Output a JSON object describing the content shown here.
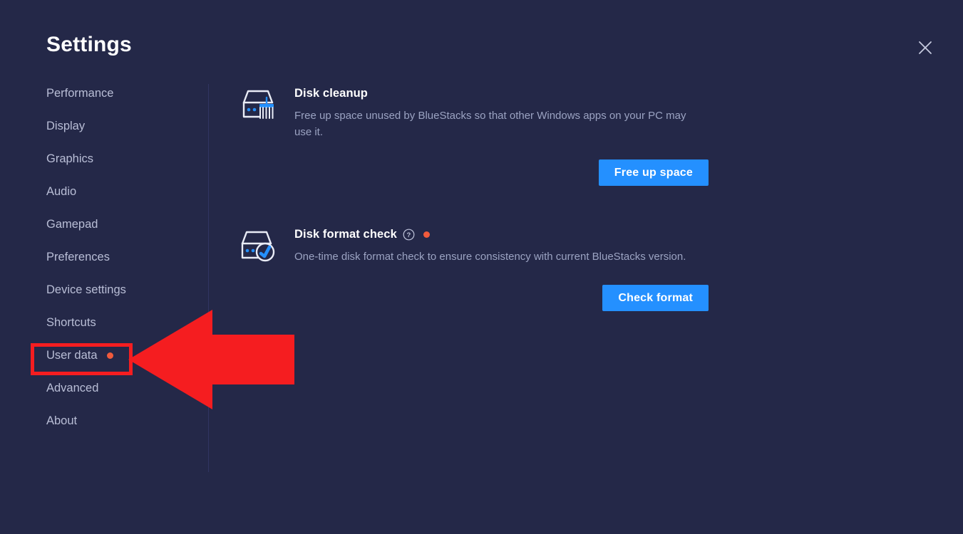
{
  "window": {
    "title": "Settings",
    "close_icon": "close-icon"
  },
  "colors": {
    "background": "#242848",
    "accent_blue": "#2490ff",
    "badge_orange": "#f05a3c",
    "annotation_red": "#f51d20",
    "divider": "#313561",
    "text_primary": "#ffffff",
    "text_secondary": "#b9bed6",
    "text_muted": "#9ba3c2"
  },
  "sidebar": {
    "items": [
      {
        "label": "Performance",
        "selected": false,
        "badge": false
      },
      {
        "label": "Display",
        "selected": false,
        "badge": false
      },
      {
        "label": "Graphics",
        "selected": false,
        "badge": false
      },
      {
        "label": "Audio",
        "selected": false,
        "badge": false
      },
      {
        "label": "Gamepad",
        "selected": false,
        "badge": false
      },
      {
        "label": "Preferences",
        "selected": false,
        "badge": false
      },
      {
        "label": "Device settings",
        "selected": false,
        "badge": false
      },
      {
        "label": "Shortcuts",
        "selected": false,
        "badge": false
      },
      {
        "label": "User data",
        "selected": true,
        "badge": true
      },
      {
        "label": "Advanced",
        "selected": false,
        "badge": false
      },
      {
        "label": "About",
        "selected": false,
        "badge": false
      }
    ]
  },
  "main": {
    "sections": [
      {
        "id": "disk-cleanup",
        "icon": "disk-brush-icon",
        "title": "Disk cleanup",
        "description": "Free up space unused by BlueStacks so that other Windows apps on your PC may use it.",
        "has_help_icon": false,
        "has_badge_dot": false,
        "button_label": "Free up space"
      },
      {
        "id": "disk-format-check",
        "icon": "disk-check-icon",
        "title": "Disk format check",
        "description": "One-time disk format check to ensure consistency with current BlueStacks version.",
        "has_help_icon": true,
        "help_icon": "help-circle-icon",
        "has_badge_dot": true,
        "button_label": "Check format"
      }
    ]
  },
  "annotation": {
    "type": "arrow-left",
    "target": "User data",
    "color": "#f51d20"
  }
}
